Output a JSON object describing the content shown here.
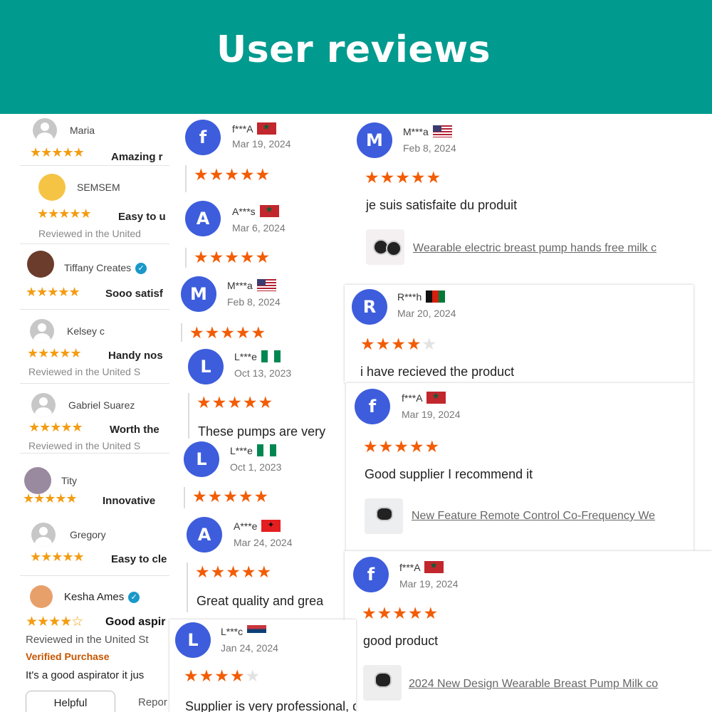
{
  "header": {
    "title": "User reviews",
    "bg_color": "#019a8e"
  },
  "amazon_reviews": [
    {
      "name": "Maria",
      "stars": "★★★★★",
      "title": "Amazing r",
      "sub": ""
    },
    {
      "name": "SEMSEM",
      "stars": "★★★★★",
      "title": "Easy to u",
      "sub": "Reviewed in the United"
    },
    {
      "name": "Tiffany Creates",
      "stars": "★★★★★",
      "title": "Sooo satisf",
      "sub": "Reviewed in the United S"
    },
    {
      "name": "Kelsey c",
      "stars": "★★★★★",
      "title": "Handy nos",
      "sub": "Reviewed in the United S"
    },
    {
      "name": "Gabriel Suarez",
      "stars": "★★★★★",
      "title": "Worth the",
      "sub": "Reviewed in the United S"
    },
    {
      "name": "Tity",
      "stars": "★★★★★",
      "title": "Innovative",
      "sub": ""
    },
    {
      "name": "Gregory",
      "stars": "★★★★★",
      "title": "Easy to cle",
      "sub": ""
    }
  ],
  "kesha": {
    "name": "Kesha Ames",
    "stars": "★★★★☆",
    "title": "Good aspir",
    "sub": "Reviewed in the United St",
    "verified": "Verified Purchase",
    "body": "It's a good aspirator it jus",
    "helpful_label": "Helpful",
    "report_label": "Repor"
  },
  "reviews": {
    "c1": {
      "initial": "f",
      "name": "f***A",
      "date": "Mar 19, 2024",
      "rating": 5
    },
    "c2": {
      "initial": "A",
      "name": "A***s",
      "date": "Mar 6, 2024",
      "rating": 5
    },
    "c3": {
      "initial": "M",
      "name": "M***a",
      "date": "Feb 8, 2024",
      "rating": 5
    },
    "c4": {
      "initial": "L",
      "name": "L***e",
      "date": "Oct 13, 2023",
      "rating": 5,
      "text": "These pumps are very"
    },
    "c5": {
      "initial": "L",
      "name": "L***e",
      "date": "Oct 1, 2023",
      "rating": 5
    },
    "c6": {
      "initial": "A",
      "name": "A***e",
      "date": "Mar 24, 2024",
      "rating": 5,
      "text": "Great quality and grea"
    },
    "c7": {
      "initial": "L",
      "name": "L***c",
      "date": "Jan 24, 2024",
      "rating": 4,
      "text": "Supplier is very professional, quality of product is good."
    },
    "r1": {
      "initial": "M",
      "name": "M***a",
      "date": "Feb 8, 2024",
      "rating": 5,
      "text": "je suis satisfaite du produit",
      "product": "Wearable electric breast pump hands free milk c"
    },
    "r2": {
      "initial": "R",
      "name": "R***h",
      "date": "Mar 20, 2024",
      "rating": 4,
      "text": "i have recieved the product"
    },
    "r3": {
      "initial": "f",
      "name": "f***A",
      "date": "Mar 19, 2024",
      "rating": 5,
      "text": "Good supplier I recommend it",
      "product": "New Feature Remote Control Co-Frequency We"
    },
    "r4": {
      "initial": "f",
      "name": "f***A",
      "date": "Mar 19, 2024",
      "rating": 5,
      "text": "good product",
      "product": "2024 New Design Wearable Breast Pump Milk co"
    }
  },
  "star_char": "★",
  "colors": {
    "star": "#f25c05",
    "avatar": "#3d5ddc",
    "amazon_star": "#f39c12"
  }
}
